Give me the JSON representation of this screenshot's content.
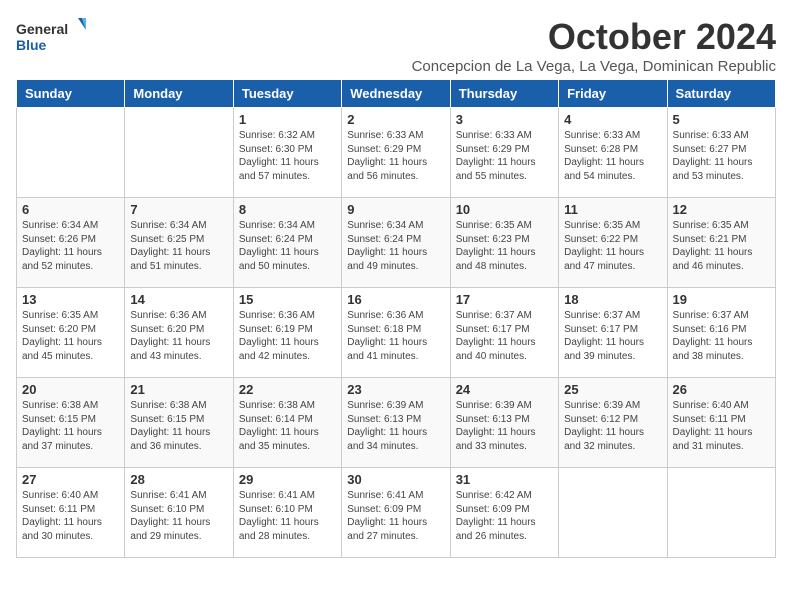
{
  "logo": {
    "line1": "General",
    "line2": "Blue"
  },
  "title": "October 2024",
  "subtitle": "Concepcion de La Vega, La Vega, Dominican Republic",
  "days_of_week": [
    "Sunday",
    "Monday",
    "Tuesday",
    "Wednesday",
    "Thursday",
    "Friday",
    "Saturday"
  ],
  "weeks": [
    [
      {
        "day": "",
        "info": ""
      },
      {
        "day": "",
        "info": ""
      },
      {
        "day": "1",
        "info": "Sunrise: 6:32 AM\nSunset: 6:30 PM\nDaylight: 11 hours and 57 minutes."
      },
      {
        "day": "2",
        "info": "Sunrise: 6:33 AM\nSunset: 6:29 PM\nDaylight: 11 hours and 56 minutes."
      },
      {
        "day": "3",
        "info": "Sunrise: 6:33 AM\nSunset: 6:29 PM\nDaylight: 11 hours and 55 minutes."
      },
      {
        "day": "4",
        "info": "Sunrise: 6:33 AM\nSunset: 6:28 PM\nDaylight: 11 hours and 54 minutes."
      },
      {
        "day": "5",
        "info": "Sunrise: 6:33 AM\nSunset: 6:27 PM\nDaylight: 11 hours and 53 minutes."
      }
    ],
    [
      {
        "day": "6",
        "info": "Sunrise: 6:34 AM\nSunset: 6:26 PM\nDaylight: 11 hours and 52 minutes."
      },
      {
        "day": "7",
        "info": "Sunrise: 6:34 AM\nSunset: 6:25 PM\nDaylight: 11 hours and 51 minutes."
      },
      {
        "day": "8",
        "info": "Sunrise: 6:34 AM\nSunset: 6:24 PM\nDaylight: 11 hours and 50 minutes."
      },
      {
        "day": "9",
        "info": "Sunrise: 6:34 AM\nSunset: 6:24 PM\nDaylight: 11 hours and 49 minutes."
      },
      {
        "day": "10",
        "info": "Sunrise: 6:35 AM\nSunset: 6:23 PM\nDaylight: 11 hours and 48 minutes."
      },
      {
        "day": "11",
        "info": "Sunrise: 6:35 AM\nSunset: 6:22 PM\nDaylight: 11 hours and 47 minutes."
      },
      {
        "day": "12",
        "info": "Sunrise: 6:35 AM\nSunset: 6:21 PM\nDaylight: 11 hours and 46 minutes."
      }
    ],
    [
      {
        "day": "13",
        "info": "Sunrise: 6:35 AM\nSunset: 6:20 PM\nDaylight: 11 hours and 45 minutes."
      },
      {
        "day": "14",
        "info": "Sunrise: 6:36 AM\nSunset: 6:20 PM\nDaylight: 11 hours and 43 minutes."
      },
      {
        "day": "15",
        "info": "Sunrise: 6:36 AM\nSunset: 6:19 PM\nDaylight: 11 hours and 42 minutes."
      },
      {
        "day": "16",
        "info": "Sunrise: 6:36 AM\nSunset: 6:18 PM\nDaylight: 11 hours and 41 minutes."
      },
      {
        "day": "17",
        "info": "Sunrise: 6:37 AM\nSunset: 6:17 PM\nDaylight: 11 hours and 40 minutes."
      },
      {
        "day": "18",
        "info": "Sunrise: 6:37 AM\nSunset: 6:17 PM\nDaylight: 11 hours and 39 minutes."
      },
      {
        "day": "19",
        "info": "Sunrise: 6:37 AM\nSunset: 6:16 PM\nDaylight: 11 hours and 38 minutes."
      }
    ],
    [
      {
        "day": "20",
        "info": "Sunrise: 6:38 AM\nSunset: 6:15 PM\nDaylight: 11 hours and 37 minutes."
      },
      {
        "day": "21",
        "info": "Sunrise: 6:38 AM\nSunset: 6:15 PM\nDaylight: 11 hours and 36 minutes."
      },
      {
        "day": "22",
        "info": "Sunrise: 6:38 AM\nSunset: 6:14 PM\nDaylight: 11 hours and 35 minutes."
      },
      {
        "day": "23",
        "info": "Sunrise: 6:39 AM\nSunset: 6:13 PM\nDaylight: 11 hours and 34 minutes."
      },
      {
        "day": "24",
        "info": "Sunrise: 6:39 AM\nSunset: 6:13 PM\nDaylight: 11 hours and 33 minutes."
      },
      {
        "day": "25",
        "info": "Sunrise: 6:39 AM\nSunset: 6:12 PM\nDaylight: 11 hours and 32 minutes."
      },
      {
        "day": "26",
        "info": "Sunrise: 6:40 AM\nSunset: 6:11 PM\nDaylight: 11 hours and 31 minutes."
      }
    ],
    [
      {
        "day": "27",
        "info": "Sunrise: 6:40 AM\nSunset: 6:11 PM\nDaylight: 11 hours and 30 minutes."
      },
      {
        "day": "28",
        "info": "Sunrise: 6:41 AM\nSunset: 6:10 PM\nDaylight: 11 hours and 29 minutes."
      },
      {
        "day": "29",
        "info": "Sunrise: 6:41 AM\nSunset: 6:10 PM\nDaylight: 11 hours and 28 minutes."
      },
      {
        "day": "30",
        "info": "Sunrise: 6:41 AM\nSunset: 6:09 PM\nDaylight: 11 hours and 27 minutes."
      },
      {
        "day": "31",
        "info": "Sunrise: 6:42 AM\nSunset: 6:09 PM\nDaylight: 11 hours and 26 minutes."
      },
      {
        "day": "",
        "info": ""
      },
      {
        "day": "",
        "info": ""
      }
    ]
  ]
}
